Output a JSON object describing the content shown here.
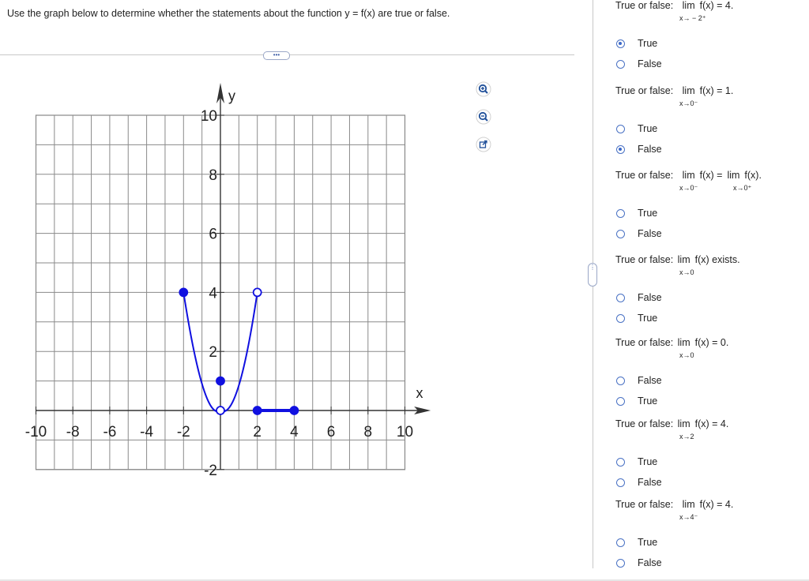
{
  "instruction": "Use the graph below to determine whether the statements about the function y = f(x) are true or false.",
  "more_label": "•••",
  "side_handle_label": "⋮",
  "tools": [
    {
      "name": "zoom-in-icon"
    },
    {
      "name": "zoom-out-icon"
    },
    {
      "name": "external-link-icon"
    }
  ],
  "chart_data": {
    "type": "line",
    "xlabel": "x",
    "ylabel": "y",
    "xlim": [
      -10,
      10
    ],
    "ylim": [
      -2,
      10
    ],
    "grid": true,
    "x_tick_labels": [
      "-10",
      "-8",
      "-6",
      "-4",
      "-2",
      "2",
      "4",
      "6",
      "8",
      "10"
    ],
    "y_tick_labels": [
      "-2",
      "2",
      "4",
      "6",
      "8",
      "10"
    ],
    "segments": [
      {
        "kind": "curve",
        "from": [
          -2,
          4
        ],
        "to": [
          2,
          4
        ],
        "through_min": [
          0,
          0
        ],
        "color": "#1010e0"
      },
      {
        "kind": "line",
        "from": [
          2,
          0
        ],
        "to": [
          4,
          0
        ],
        "color": "#1010e0"
      }
    ],
    "points": [
      {
        "x": -2,
        "y": 4,
        "filled": true
      },
      {
        "x": 0,
        "y": 1,
        "filled": true
      },
      {
        "x": 0,
        "y": 0,
        "filled": false
      },
      {
        "x": 2,
        "y": 4,
        "filled": false
      },
      {
        "x": 2,
        "y": 0,
        "filled": true
      },
      {
        "x": 4,
        "y": 0,
        "filled": true
      }
    ]
  },
  "questions": [
    {
      "prefix": "True or false:",
      "lim": "lim",
      "expr": "f(x) = 4.",
      "sub": "x→ − 2⁺",
      "options": [
        "True",
        "False"
      ],
      "selected": 0
    },
    {
      "prefix": "True or false:",
      "lim": "lim",
      "expr": "f(x) = 1.",
      "sub": "x→0⁻",
      "options": [
        "True",
        "False"
      ],
      "selected": 1
    },
    {
      "prefix": "True or false:",
      "lim": "lim",
      "expr": "f(x) =",
      "lim2": "lim",
      "expr2": "f(x).",
      "sub": "x→0⁻",
      "sub2": "x→0⁺",
      "options": [
        "True",
        "False"
      ],
      "selected": -1
    },
    {
      "prefix": "True or false:",
      "lim": "lim",
      "expr": "f(x) exists.",
      "sub": "x→0",
      "options": [
        "False",
        "True"
      ],
      "selected": -1
    },
    {
      "prefix": "True or false:",
      "lim": "lim",
      "expr": "f(x) = 0.",
      "sub": "x→0",
      "options": [
        "False",
        "True"
      ],
      "selected": -1
    },
    {
      "prefix": "True or false:",
      "lim": "lim",
      "expr": "f(x) = 4.",
      "sub": "x→2",
      "options": [
        "True",
        "False"
      ],
      "selected": -1
    },
    {
      "prefix": "True or false:",
      "lim": "lim",
      "expr": "f(x) = 4.",
      "sub": "x→4⁻",
      "options": [
        "True",
        "False"
      ],
      "selected": -1
    }
  ]
}
